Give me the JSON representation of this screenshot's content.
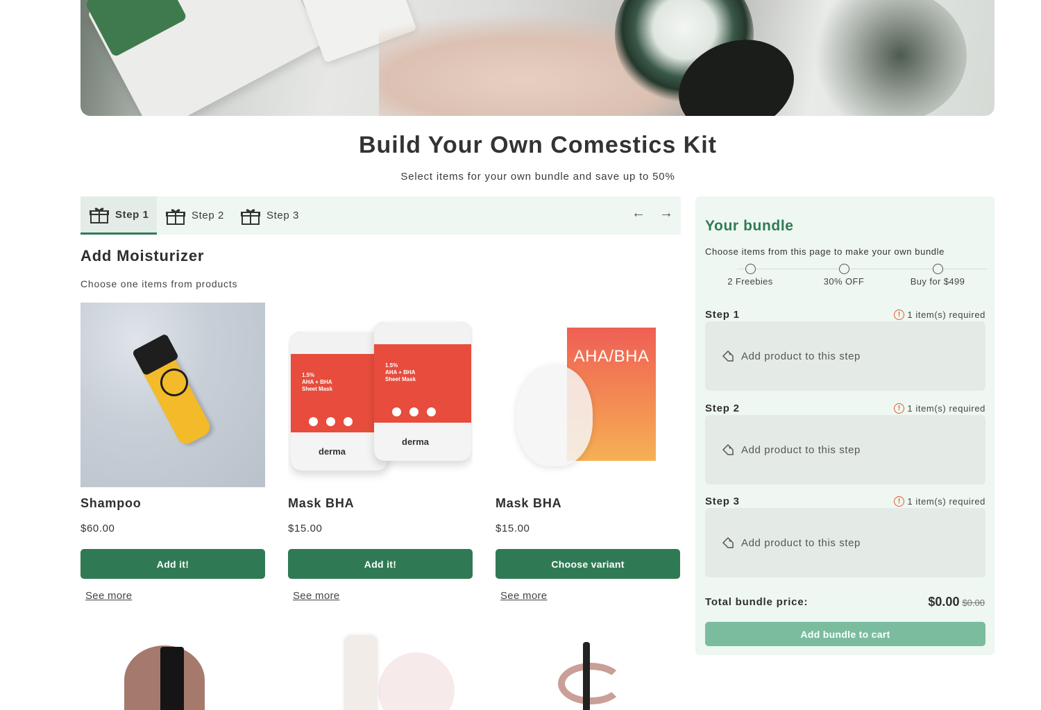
{
  "hero": {
    "image": "cosmetics-hero-banner"
  },
  "page": {
    "title": "Build Your Own Comestics Kit",
    "subtitle": "Select items for your own bundle and save up to 50%"
  },
  "steps": {
    "tabs": [
      {
        "label": "Step 1",
        "active": true
      },
      {
        "label": "Step 2",
        "active": false
      },
      {
        "label": "Step 3",
        "active": false
      }
    ],
    "prev_icon": "arrow-left-icon",
    "next_icon": "arrow-right-icon"
  },
  "section": {
    "title": "Add Moisturizer",
    "subtitle": "Choose one items from products"
  },
  "products": [
    {
      "name": "Shampoo",
      "price": "$60.00",
      "button": "Add it!",
      "link": "See more"
    },
    {
      "name": "Mask BHA",
      "price": "$15.00",
      "button": "Add it!",
      "link": "See more"
    },
    {
      "name": "Mask BHA",
      "price": "$15.00",
      "button": "Choose variant",
      "link": "See more"
    }
  ],
  "product_art": {
    "pack_text": "1.5%\nAHA + BHA\nSheet Mask",
    "pack_logo": "derma",
    "aha_label": "AHA/BHA"
  },
  "bundle": {
    "title": "Your bundle",
    "subtitle": "Choose items from this page to make your own bundle",
    "tiers": [
      "2 Freebies",
      "30% OFF",
      "Buy for $499"
    ],
    "steps": [
      {
        "name": "Step 1",
        "requirement": "1 item(s) required",
        "slot": "Add product to this step"
      },
      {
        "name": "Step 2",
        "requirement": "1 item(s) required",
        "slot": "Add product to this step"
      },
      {
        "name": "Step 3",
        "requirement": "1 item(s) required",
        "slot": "Add product to this step"
      }
    ],
    "total_label": "Total bundle price:",
    "total_price": "$0.00",
    "original_price": "$0.00",
    "cta": "Add bundle to cart"
  },
  "colors": {
    "accent": "#2f7a55",
    "accent_light": "#7bbc9f",
    "panel_bg": "#eef7f1",
    "warning": "#e25b2c"
  }
}
